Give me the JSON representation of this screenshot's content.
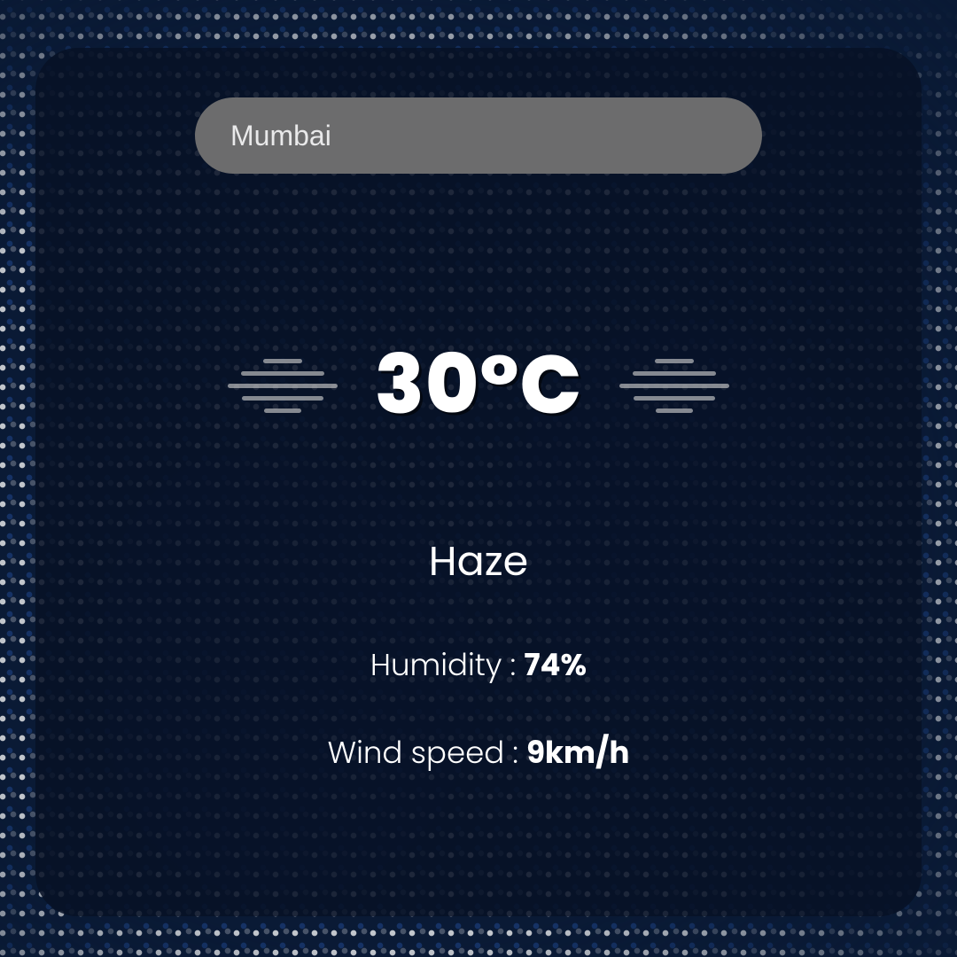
{
  "search": {
    "value": "Mumbai"
  },
  "weather": {
    "temperature": "30°C",
    "condition": "Haze",
    "humidity_label": "Humidity : ",
    "humidity_value": "74%",
    "wind_label": "Wind speed : ",
    "wind_value": "9km/h",
    "icon": "haze-icon"
  }
}
